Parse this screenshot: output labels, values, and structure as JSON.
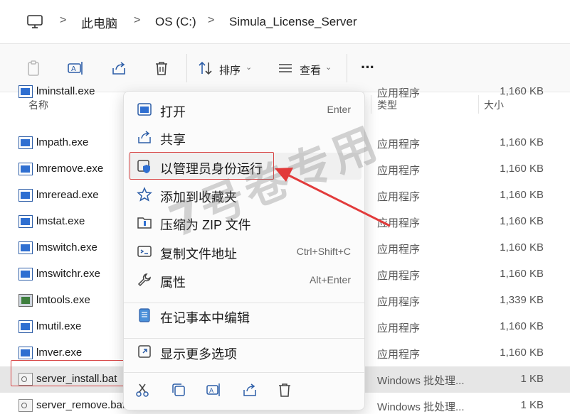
{
  "breadcrumb": {
    "items": [
      "此电脑",
      "OS (C:)",
      "Simula_License_Server"
    ],
    "separator": ">"
  },
  "toolbar": {
    "sort_label": "排序",
    "view_label": "查看",
    "more_label": "···"
  },
  "columns": {
    "name": "名称",
    "type": "类型",
    "size": "大小"
  },
  "files": [
    {
      "name": "lminstall.exe",
      "type": "应用程序",
      "size": "1,160 KB",
      "icon": "exe"
    },
    {
      "name": "lmpath.exe",
      "type": "应用程序",
      "size": "1,160 KB",
      "icon": "exe"
    },
    {
      "name": "lmremove.exe",
      "type": "应用程序",
      "size": "1,160 KB",
      "icon": "exe"
    },
    {
      "name": "lmreread.exe",
      "type": "应用程序",
      "size": "1,160 KB",
      "icon": "exe"
    },
    {
      "name": "lmstat.exe",
      "type": "应用程序",
      "size": "1,160 KB",
      "icon": "exe"
    },
    {
      "name": "lmswitch.exe",
      "type": "应用程序",
      "size": "1,160 KB",
      "icon": "exe"
    },
    {
      "name": "lmswitchr.exe",
      "type": "应用程序",
      "size": "1,160 KB",
      "icon": "exe"
    },
    {
      "name": "lmtools.exe",
      "type": "应用程序",
      "size": "1,339 KB",
      "icon": "tool"
    },
    {
      "name": "lmutil.exe",
      "type": "应用程序",
      "size": "1,160 KB",
      "icon": "exe"
    },
    {
      "name": "lmver.exe",
      "type": "应用程序",
      "size": "1,160 KB",
      "icon": "exe"
    },
    {
      "name": "server_install.bat",
      "type": "Windows 批处理...",
      "size": "1 KB",
      "icon": "bat",
      "selected": true
    },
    {
      "name": "server_remove.bat",
      "type": "Windows 批处理...",
      "size": "1 KB",
      "icon": "bat"
    }
  ],
  "context_menu": {
    "items": [
      {
        "label": "打开",
        "shortcut": "Enter",
        "icon": "open-icon"
      },
      {
        "label": "共享",
        "shortcut": "",
        "icon": "share-icon"
      },
      {
        "label": "以管理员身份运行",
        "shortcut": "",
        "icon": "shield-icon"
      },
      {
        "label": "添加到收藏夹",
        "shortcut": "",
        "icon": "star-icon"
      },
      {
        "label": "压缩为 ZIP 文件",
        "shortcut": "",
        "icon": "zip-icon"
      },
      {
        "label": "复制文件地址",
        "shortcut": "Ctrl+Shift+C",
        "icon": "copy-path-icon"
      },
      {
        "label": "属性",
        "shortcut": "Alt+Enter",
        "icon": "wrench-icon"
      },
      {
        "label": "在记事本中编辑",
        "shortcut": "",
        "icon": "notepad-icon"
      },
      {
        "label": "显示更多选项",
        "shortcut": "",
        "icon": "expand-icon"
      }
    ]
  },
  "watermark": "7号卷专用",
  "colors": {
    "accent": "#2f6fd1",
    "highlight": "#d84444",
    "selected_row": "#e6e6e6"
  }
}
